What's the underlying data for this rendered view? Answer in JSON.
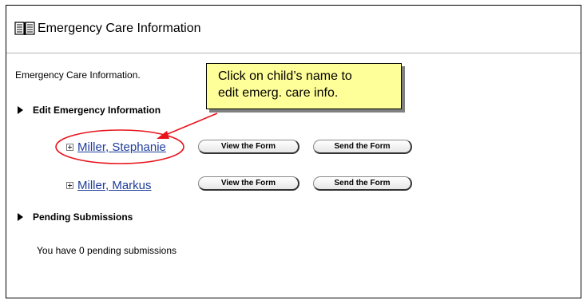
{
  "header": {
    "title": "Emergency Care Information",
    "icon": "open-book-icon"
  },
  "intro": {
    "text": "Emergency Care Information."
  },
  "sections": {
    "edit": {
      "heading": "Edit Emergency Information"
    },
    "pending": {
      "heading": "Pending Submissions",
      "status": "You have 0 pending submissions"
    }
  },
  "children": [
    {
      "name": "Miller, Stephanie",
      "view_label": "View the Form",
      "send_label": "Send the Form"
    },
    {
      "name": "Miller, Markus",
      "view_label": "View the Form",
      "send_label": "Send the Form"
    }
  ],
  "callout": {
    "line1": "Click on child’s name to",
    "line2": "edit emerg. care info."
  },
  "colors": {
    "link": "#1e3d9a",
    "callout_bg": "#ffff99",
    "annotation": "#e8131b"
  }
}
